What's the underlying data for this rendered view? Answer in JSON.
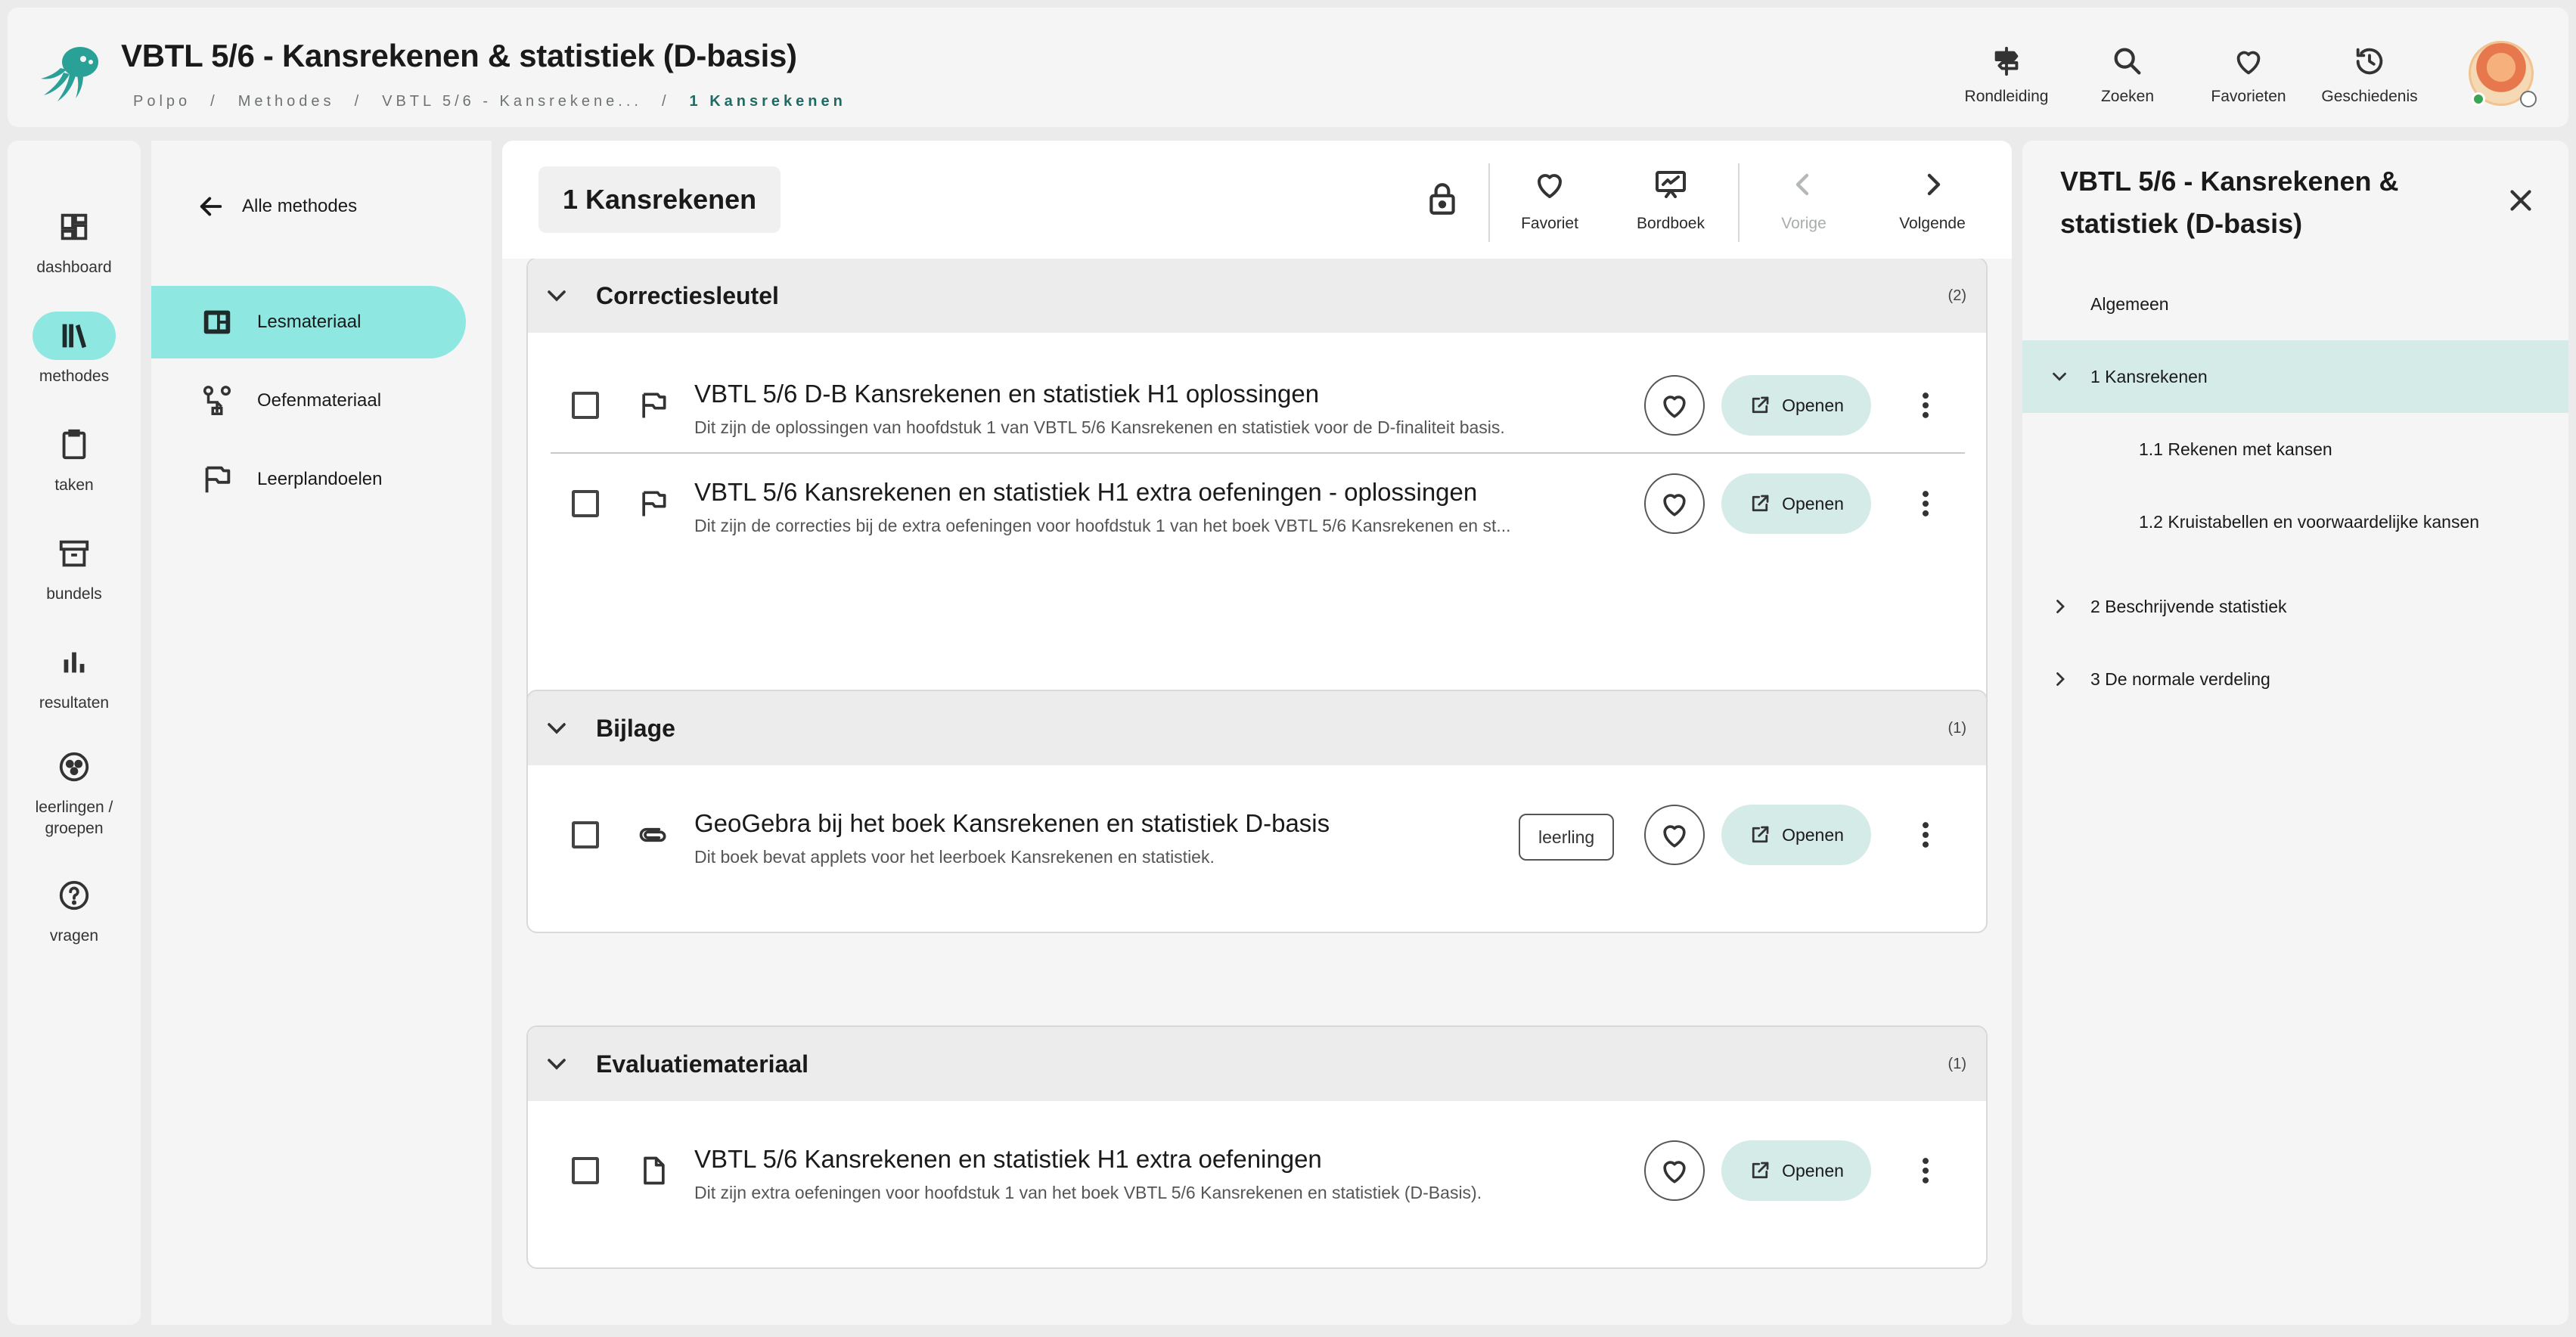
{
  "header": {
    "title": "VBTL 5/6 - Kansrekenen & statistiek (D-basis)",
    "breadcrumb": [
      "Polpo",
      "Methodes",
      "VBTL 5/6 - Kansrekene...",
      "1 Kansrekenen"
    ],
    "breadcrumb_separator": "/",
    "nav": [
      {
        "label": "Rondleiding",
        "icon": "signpost-icon"
      },
      {
        "label": "Zoeken",
        "icon": "search-icon"
      },
      {
        "label": "Favorieten",
        "icon": "heart-icon"
      },
      {
        "label": "Geschiedenis",
        "icon": "history-icon"
      }
    ]
  },
  "rail": {
    "items": [
      {
        "label": "dashboard",
        "icon": "dashboard-icon"
      },
      {
        "label": "methodes",
        "icon": "books-icon",
        "active": true
      },
      {
        "label": "taken",
        "icon": "clipboard-icon"
      },
      {
        "label": "bundels",
        "icon": "archive-icon"
      },
      {
        "label": "resultaten",
        "icon": "bar-chart-icon"
      },
      {
        "label": "leerlingen / groepen",
        "icon": "students-icon"
      },
      {
        "label": "vragen",
        "icon": "help-icon"
      }
    ]
  },
  "subnav": {
    "back_label": "Alle methodes",
    "items": [
      {
        "label": "Lesmateriaal",
        "icon": "dashboard-icon",
        "active": true
      },
      {
        "label": "Oefenmateriaal",
        "icon": "exercise-icon"
      },
      {
        "label": "Leerplandoelen",
        "icon": "flag-icon"
      }
    ]
  },
  "toolbar": {
    "chapter": "1 Kansrekenen",
    "favoriet_label": "Favoriet",
    "bordboek_label": "Bordboek",
    "vorige_label": "Vorige",
    "volgende_label": "Volgende"
  },
  "sections": [
    {
      "title": "Correctiesleutel",
      "count": "(2)",
      "items": [
        {
          "title": "VBTL 5/6 D-B Kansrekenen en statistiek H1 oplossingen",
          "description": "Dit zijn de oplossingen van hoofdstuk 1 van VBTL 5/6 Kansrekenen en statistiek voor de D-finaliteit basis.",
          "type_icon": "flag-icon",
          "open_label": "Openen"
        },
        {
          "title": "VBTL 5/6 Kansrekenen en statistiek H1 extra oefeningen - oplossingen",
          "description": "Dit zijn de correcties bij de extra oefeningen voor hoofdstuk 1 van het boek VBTL 5/6 Kansrekenen en st...",
          "type_icon": "flag-icon",
          "open_label": "Openen"
        }
      ]
    },
    {
      "title": "Bijlage",
      "count": "(1)",
      "items": [
        {
          "title": "GeoGebra bij het boek Kansrekenen en statistiek D-basis",
          "description": "Dit boek bevat applets voor het leerboek Kansrekenen en statistiek.",
          "type_icon": "paperclip-icon",
          "badge": "leerling",
          "open_label": "Openen"
        }
      ]
    },
    {
      "title": "Evaluatiemateriaal",
      "count": "(1)",
      "items": [
        {
          "title": "VBTL 5/6 Kansrekenen en statistiek H1 extra oefeningen",
          "description": "Dit zijn extra oefeningen voor hoofdstuk 1 van het boek VBTL 5/6 Kansrekenen en statistiek (D-Basis).",
          "type_icon": "document-icon",
          "open_label": "Openen"
        }
      ]
    }
  ],
  "rpanel": {
    "title": "VBTL 5/6 - Kansrekenen & statistiek (D-basis)",
    "toc": [
      {
        "label": "Algemeen",
        "level": 0
      },
      {
        "label": "1 Kansrekenen",
        "level": 0,
        "expanded": true,
        "active": true
      },
      {
        "label": "1.1 Rekenen met kansen",
        "level": 1
      },
      {
        "label": "1.2 Kruistabellen en voorwaardelijke kansen",
        "level": 1
      },
      {
        "label": "2 Beschrijvende statistiek",
        "level": 0,
        "expanded": false
      },
      {
        "label": "3 De normale verdeling",
        "level": 0,
        "expanded": false
      }
    ]
  },
  "colors": {
    "accent": "#8ee8e1",
    "accent_soft": "#d5ebe8",
    "active_crumb": "#1f6b63",
    "logo": "#2aa197"
  }
}
